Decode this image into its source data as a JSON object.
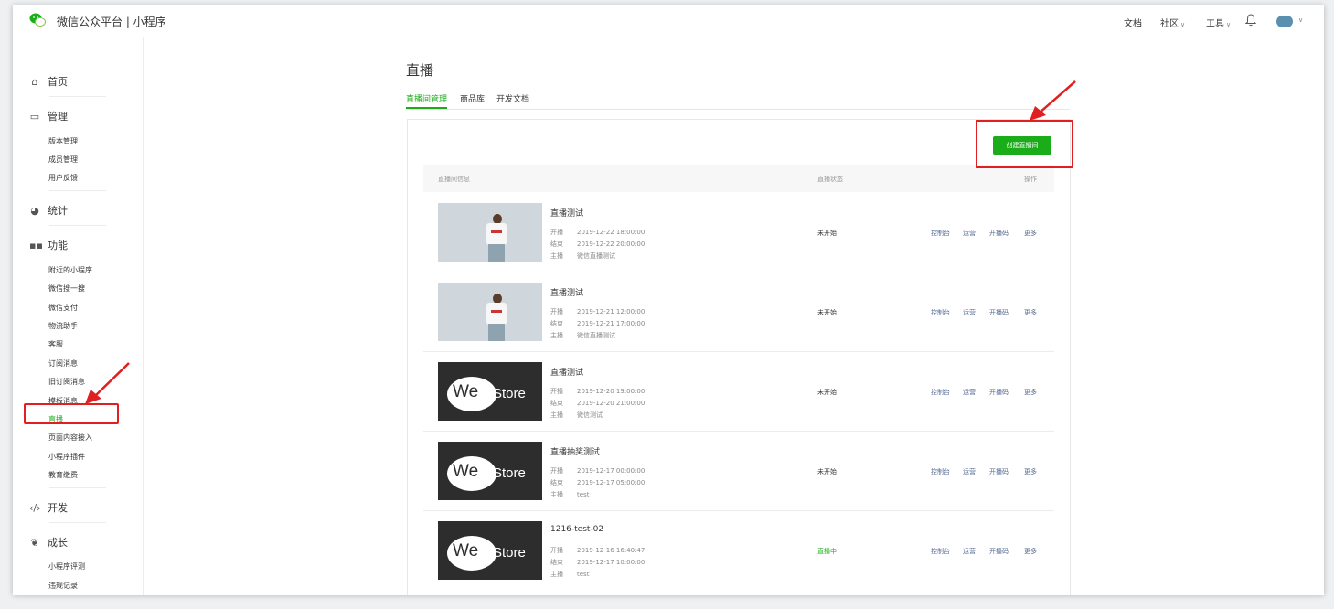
{
  "header": {
    "brand": "微信公众平台 | 小程序",
    "nav": {
      "docs": "文档",
      "community": "社区",
      "tools": "工具"
    }
  },
  "sidebar": {
    "sections": {
      "home": "首页",
      "manage": "管理",
      "stats": "统计",
      "features": "功能",
      "dev": "开发",
      "growth": "成长"
    },
    "manage_items": [
      "版本管理",
      "成员管理",
      "用户反馈"
    ],
    "feature_items": [
      "附近的小程序",
      "微信搜一搜",
      "微信支付",
      "物流助手",
      "客服",
      "订阅消息",
      "旧订阅消息",
      "模板消息",
      "直播",
      "页面内容接入",
      "小程序插件",
      "教育缴费"
    ],
    "growth_items": [
      "小程序评测",
      "违规记录"
    ],
    "active_item": "直播"
  },
  "page": {
    "title": "直播",
    "tabs": [
      "直播间管理",
      "商品库",
      "开发文档"
    ],
    "create_button": "创建直播间",
    "columns": {
      "info": "直播间信息",
      "status": "直播状态",
      "ops": "操作"
    },
    "meta_labels": {
      "start": "开播",
      "end": "结束",
      "host": "主播"
    },
    "op_labels": [
      "控制台",
      "运营",
      "开播码",
      "更多"
    ],
    "rooms": [
      {
        "title": "直播测试",
        "start": "2019-12-22 18:00:00",
        "end": "2019-12-22 20:00:00",
        "host": "微信直播测试",
        "status": "未开始",
        "cover": "photo"
      },
      {
        "title": "直播测试",
        "start": "2019-12-21 12:00:00",
        "end": "2019-12-21 17:00:00",
        "host": "微信直播测试",
        "status": "未开始",
        "cover": "photo"
      },
      {
        "title": "直播测试",
        "start": "2019-12-20 19:00:00",
        "end": "2019-12-20 21:00:00",
        "host": "微信测试",
        "status": "未开始",
        "cover": "westore"
      },
      {
        "title": "直播抽奖测试",
        "start": "2019-12-17 00:00:00",
        "end": "2019-12-17 05:00:00",
        "host": "test",
        "status": "未开始",
        "cover": "westore"
      },
      {
        "title": "1216-test-02",
        "start": "2019-12-16 16:40:47",
        "end": "2019-12-17 10:00:00",
        "host": "test",
        "status": "直播中",
        "cover": "westore"
      }
    ],
    "cover_text": {
      "we": "We",
      "store": "Store"
    }
  },
  "colors": {
    "accent": "#1aad19",
    "link": "#576b95",
    "annotation": "#e02020"
  }
}
